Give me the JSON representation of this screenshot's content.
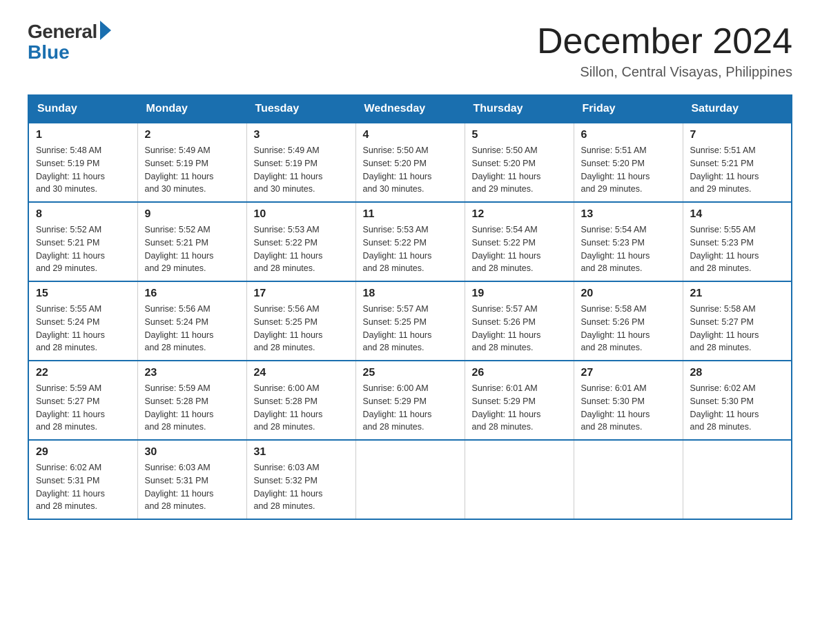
{
  "header": {
    "logo_general": "General",
    "logo_blue": "Blue",
    "title": "December 2024",
    "location": "Sillon, Central Visayas, Philippines"
  },
  "days_of_week": [
    "Sunday",
    "Monday",
    "Tuesday",
    "Wednesday",
    "Thursday",
    "Friday",
    "Saturday"
  ],
  "weeks": [
    [
      {
        "day": "1",
        "sunrise": "5:48 AM",
        "sunset": "5:19 PM",
        "daylight": "11 hours and 30 minutes."
      },
      {
        "day": "2",
        "sunrise": "5:49 AM",
        "sunset": "5:19 PM",
        "daylight": "11 hours and 30 minutes."
      },
      {
        "day": "3",
        "sunrise": "5:49 AM",
        "sunset": "5:19 PM",
        "daylight": "11 hours and 30 minutes."
      },
      {
        "day": "4",
        "sunrise": "5:50 AM",
        "sunset": "5:20 PM",
        "daylight": "11 hours and 30 minutes."
      },
      {
        "day": "5",
        "sunrise": "5:50 AM",
        "sunset": "5:20 PM",
        "daylight": "11 hours and 29 minutes."
      },
      {
        "day": "6",
        "sunrise": "5:51 AM",
        "sunset": "5:20 PM",
        "daylight": "11 hours and 29 minutes."
      },
      {
        "day": "7",
        "sunrise": "5:51 AM",
        "sunset": "5:21 PM",
        "daylight": "11 hours and 29 minutes."
      }
    ],
    [
      {
        "day": "8",
        "sunrise": "5:52 AM",
        "sunset": "5:21 PM",
        "daylight": "11 hours and 29 minutes."
      },
      {
        "day": "9",
        "sunrise": "5:52 AM",
        "sunset": "5:21 PM",
        "daylight": "11 hours and 29 minutes."
      },
      {
        "day": "10",
        "sunrise": "5:53 AM",
        "sunset": "5:22 PM",
        "daylight": "11 hours and 28 minutes."
      },
      {
        "day": "11",
        "sunrise": "5:53 AM",
        "sunset": "5:22 PM",
        "daylight": "11 hours and 28 minutes."
      },
      {
        "day": "12",
        "sunrise": "5:54 AM",
        "sunset": "5:22 PM",
        "daylight": "11 hours and 28 minutes."
      },
      {
        "day": "13",
        "sunrise": "5:54 AM",
        "sunset": "5:23 PM",
        "daylight": "11 hours and 28 minutes."
      },
      {
        "day": "14",
        "sunrise": "5:55 AM",
        "sunset": "5:23 PM",
        "daylight": "11 hours and 28 minutes."
      }
    ],
    [
      {
        "day": "15",
        "sunrise": "5:55 AM",
        "sunset": "5:24 PM",
        "daylight": "11 hours and 28 minutes."
      },
      {
        "day": "16",
        "sunrise": "5:56 AM",
        "sunset": "5:24 PM",
        "daylight": "11 hours and 28 minutes."
      },
      {
        "day": "17",
        "sunrise": "5:56 AM",
        "sunset": "5:25 PM",
        "daylight": "11 hours and 28 minutes."
      },
      {
        "day": "18",
        "sunrise": "5:57 AM",
        "sunset": "5:25 PM",
        "daylight": "11 hours and 28 minutes."
      },
      {
        "day": "19",
        "sunrise": "5:57 AM",
        "sunset": "5:26 PM",
        "daylight": "11 hours and 28 minutes."
      },
      {
        "day": "20",
        "sunrise": "5:58 AM",
        "sunset": "5:26 PM",
        "daylight": "11 hours and 28 minutes."
      },
      {
        "day": "21",
        "sunrise": "5:58 AM",
        "sunset": "5:27 PM",
        "daylight": "11 hours and 28 minutes."
      }
    ],
    [
      {
        "day": "22",
        "sunrise": "5:59 AM",
        "sunset": "5:27 PM",
        "daylight": "11 hours and 28 minutes."
      },
      {
        "day": "23",
        "sunrise": "5:59 AM",
        "sunset": "5:28 PM",
        "daylight": "11 hours and 28 minutes."
      },
      {
        "day": "24",
        "sunrise": "6:00 AM",
        "sunset": "5:28 PM",
        "daylight": "11 hours and 28 minutes."
      },
      {
        "day": "25",
        "sunrise": "6:00 AM",
        "sunset": "5:29 PM",
        "daylight": "11 hours and 28 minutes."
      },
      {
        "day": "26",
        "sunrise": "6:01 AM",
        "sunset": "5:29 PM",
        "daylight": "11 hours and 28 minutes."
      },
      {
        "day": "27",
        "sunrise": "6:01 AM",
        "sunset": "5:30 PM",
        "daylight": "11 hours and 28 minutes."
      },
      {
        "day": "28",
        "sunrise": "6:02 AM",
        "sunset": "5:30 PM",
        "daylight": "11 hours and 28 minutes."
      }
    ],
    [
      {
        "day": "29",
        "sunrise": "6:02 AM",
        "sunset": "5:31 PM",
        "daylight": "11 hours and 28 minutes."
      },
      {
        "day": "30",
        "sunrise": "6:03 AM",
        "sunset": "5:31 PM",
        "daylight": "11 hours and 28 minutes."
      },
      {
        "day": "31",
        "sunrise": "6:03 AM",
        "sunset": "5:32 PM",
        "daylight": "11 hours and 28 minutes."
      },
      null,
      null,
      null,
      null
    ]
  ],
  "labels": {
    "sunrise": "Sunrise:",
    "sunset": "Sunset:",
    "daylight": "Daylight:"
  }
}
